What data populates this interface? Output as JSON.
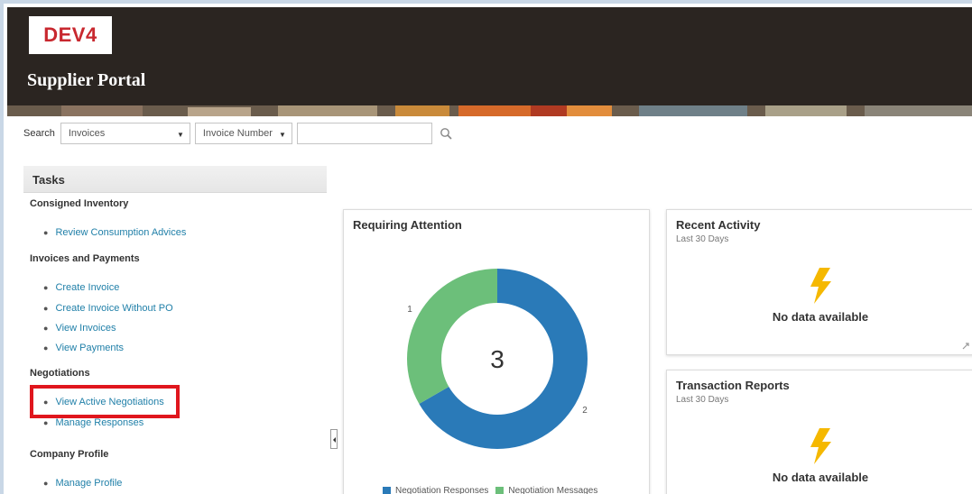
{
  "header": {
    "env_badge": "DEV4",
    "portal_title": "Supplier Portal"
  },
  "search": {
    "label": "Search",
    "category": "Invoices",
    "field": "Invoice Number",
    "query": ""
  },
  "tasks": {
    "title": "Tasks",
    "sections": [
      {
        "label": "Consigned Inventory",
        "links": [
          "Review Consumption Advices"
        ]
      },
      {
        "label": "Invoices and Payments",
        "links": [
          "Create Invoice",
          "Create Invoice Without PO",
          "View Invoices",
          "View Payments"
        ]
      },
      {
        "label": "Negotiations",
        "links": [
          "View Active Negotiations",
          "Manage Responses"
        ]
      },
      {
        "label": "Company Profile",
        "links": [
          "Manage Profile"
        ]
      }
    ]
  },
  "requiring_attention": {
    "title": "Requiring Attention",
    "total": "3"
  },
  "recent_activity": {
    "title": "Recent Activity",
    "subtitle": "Last 30 Days",
    "message": "No data available"
  },
  "transaction_reports": {
    "title": "Transaction Reports",
    "subtitle": "Last 30 Days",
    "message": "No data available"
  },
  "colors": {
    "negotiation_responses": "#2a7ab8",
    "negotiation_messages": "#6cbf7a",
    "link": "#1f7fa8",
    "bolt": "#f5b800"
  },
  "chart_data": {
    "type": "pie",
    "title": "Requiring Attention",
    "center_label": "3",
    "categories": [
      "Negotiation Responses",
      "Negotiation Messages"
    ],
    "values": [
      2,
      1
    ],
    "data_labels": [
      "2",
      "1"
    ],
    "legend": "bottom"
  }
}
